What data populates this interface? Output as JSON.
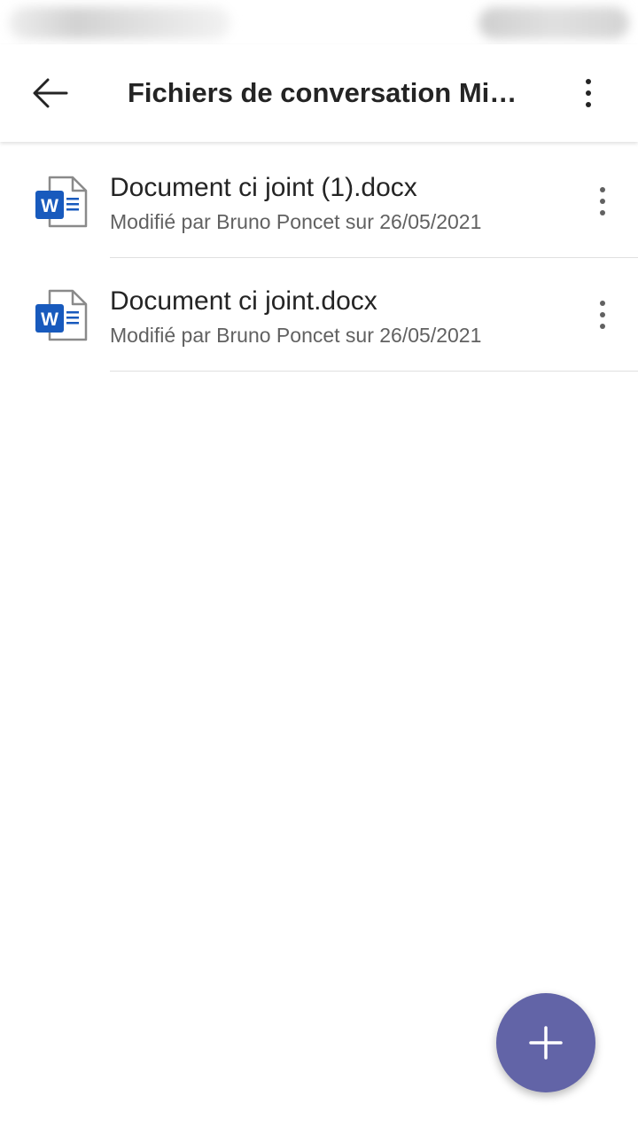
{
  "header": {
    "title": "Fichiers de conversation Mic…",
    "back_icon": "arrow-left-icon",
    "menu_icon": "more-vertical-icon"
  },
  "files": [
    {
      "name": "Document ci joint (1).docx",
      "meta": "Modifié par Bruno Poncet sur 26/05/2021",
      "icon": "word-document-icon"
    },
    {
      "name": "Document ci joint.docx",
      "meta": "Modifié par Bruno Poncet sur 26/05/2021",
      "icon": "word-document-icon"
    }
  ],
  "fab": {
    "icon": "plus-icon"
  },
  "colors": {
    "accent": "#6264a7",
    "word_blue": "#185abd",
    "text_primary": "#242424",
    "text_secondary": "#616161"
  }
}
